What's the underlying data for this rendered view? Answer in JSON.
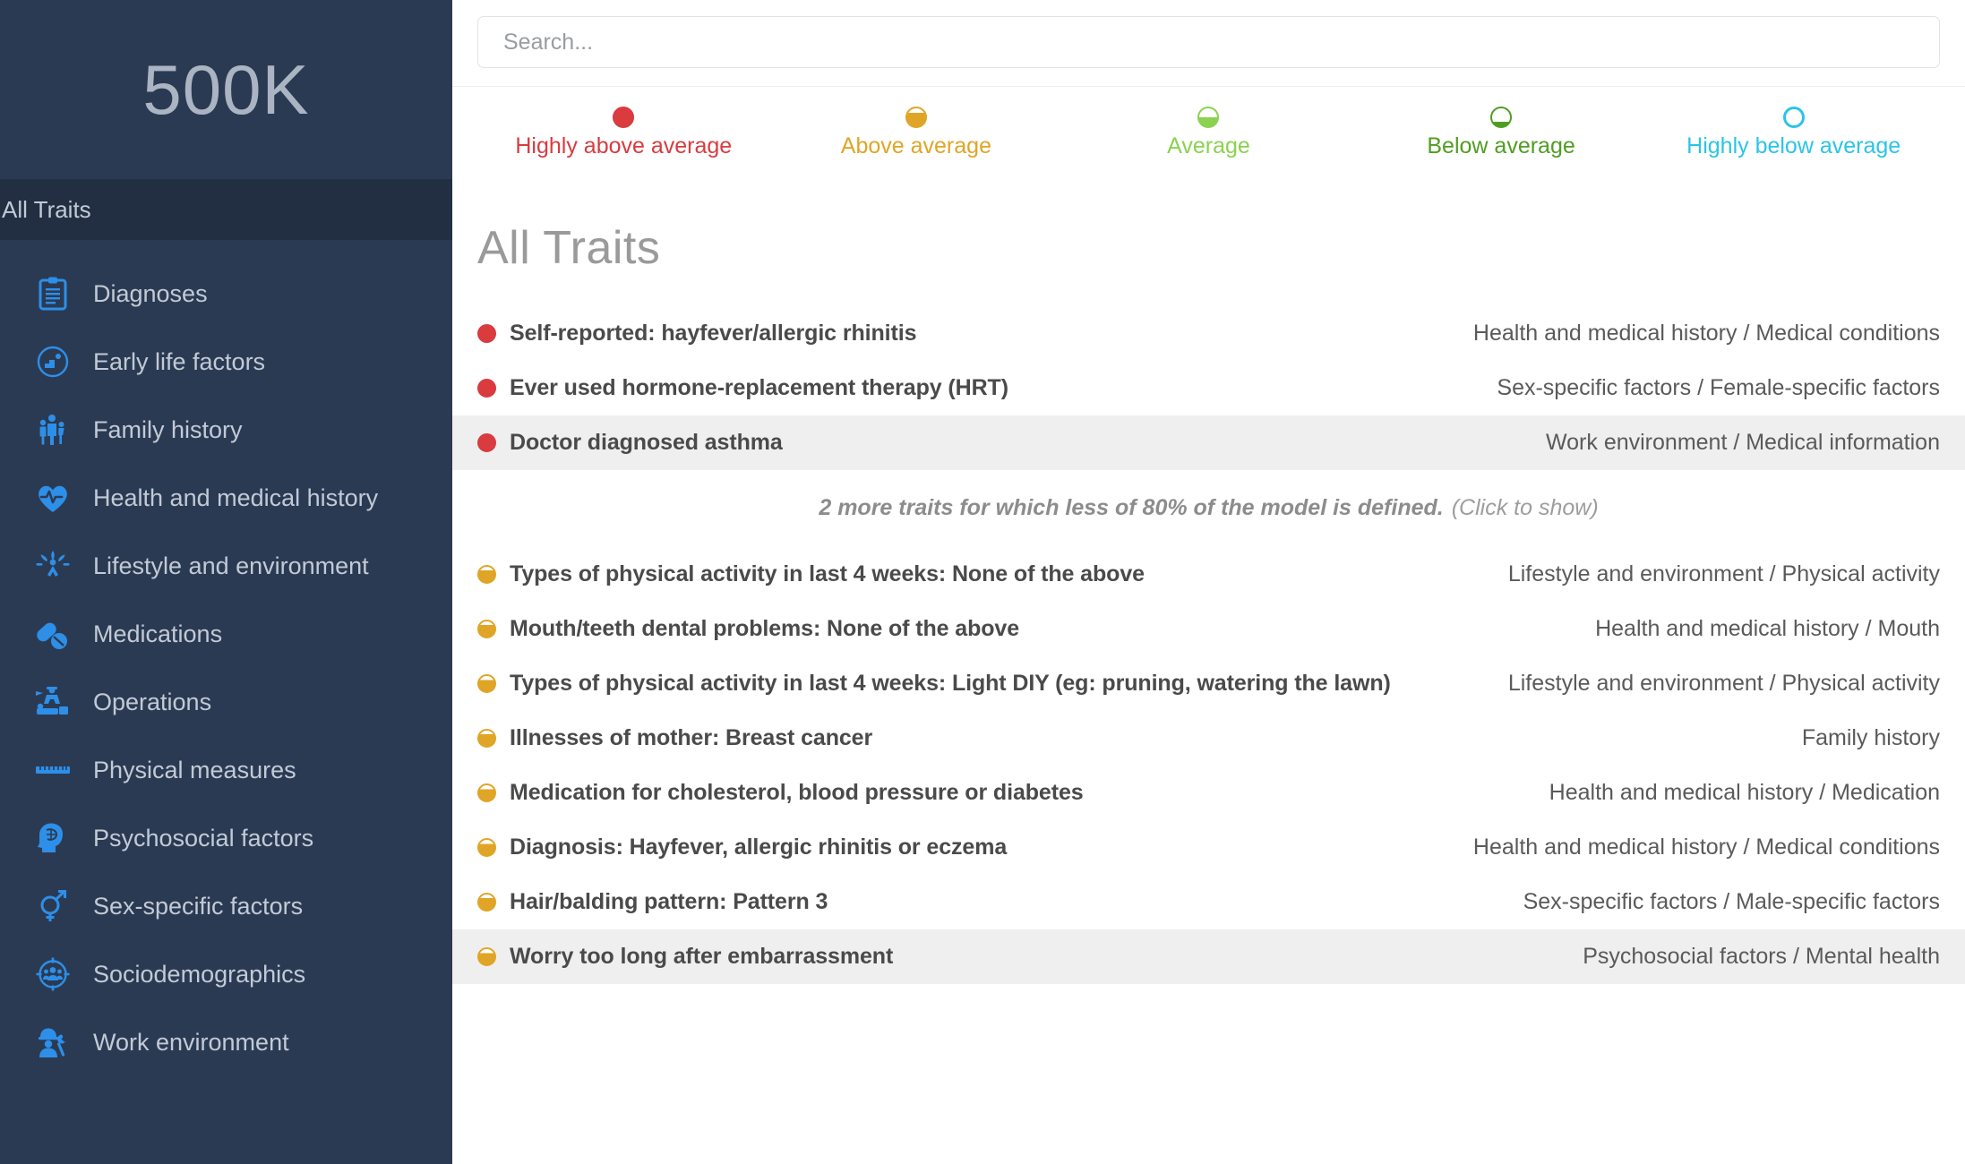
{
  "sidebar": {
    "brand": "500K",
    "active_section": "All Traits",
    "items": [
      {
        "label": "Diagnoses",
        "icon": "clipboard-icon"
      },
      {
        "label": "Early life factors",
        "icon": "baby-icon"
      },
      {
        "label": "Family history",
        "icon": "family-icon"
      },
      {
        "label": "Health and medical history",
        "icon": "heart-pulse-icon"
      },
      {
        "label": "Lifestyle and environment",
        "icon": "lifestyle-tree-icon"
      },
      {
        "label": "Medications",
        "icon": "pills-icon"
      },
      {
        "label": "Operations",
        "icon": "surgery-icon"
      },
      {
        "label": "Physical measures",
        "icon": "ruler-icon"
      },
      {
        "label": "Psychosocial factors",
        "icon": "head-brain-icon"
      },
      {
        "label": "Sex-specific factors",
        "icon": "gender-symbols-icon"
      },
      {
        "label": "Sociodemographics",
        "icon": "people-target-icon"
      },
      {
        "label": "Work environment",
        "icon": "worker-icon"
      }
    ]
  },
  "search": {
    "placeholder": "Search...",
    "value": ""
  },
  "legend": {
    "items": [
      {
        "label": "Highly above average",
        "color": "#d93b3f",
        "fill": 100
      },
      {
        "label": "Above average",
        "color": "#e0a526",
        "fill": 75
      },
      {
        "label": "Average",
        "color": "#8bd24f",
        "fill": 50
      },
      {
        "label": "Below average",
        "color": "#509e21",
        "fill": 25
      },
      {
        "label": "Highly below average",
        "color": "#2bc4e8",
        "fill": 0
      }
    ]
  },
  "main": {
    "title": "All Traits",
    "more_traits_strong": "2 more traits for which less of 80% of the model is defined.",
    "more_traits_click": "(Click to show)"
  },
  "traits_top": [
    {
      "name": "Self-reported: hayfever/allergic rhinitis",
      "category": "Health and medical history / Medical conditions",
      "color": "#d93b3f",
      "fill": 100,
      "shaded": false
    },
    {
      "name": "Ever used hormone-replacement therapy (HRT)",
      "category": "Sex-specific factors / Female-specific factors",
      "color": "#d93b3f",
      "fill": 100,
      "shaded": false
    },
    {
      "name": "Doctor diagnosed asthma",
      "category": "Work environment / Medical information",
      "color": "#d93b3f",
      "fill": 100,
      "shaded": true
    }
  ],
  "traits_bottom": [
    {
      "name": "Types of physical activity in last 4 weeks: None of the above",
      "category": "Lifestyle and environment / Physical activity",
      "color": "#e0a526",
      "fill": 75,
      "shaded": false
    },
    {
      "name": "Mouth/teeth dental problems: None of the above",
      "category": "Health and medical history / Mouth",
      "color": "#e0a526",
      "fill": 75,
      "shaded": false
    },
    {
      "name": "Types of physical activity in last 4 weeks: Light DIY (eg: pruning, watering the lawn)",
      "category": "Lifestyle and environment / Physical activity",
      "color": "#e0a526",
      "fill": 75,
      "shaded": false
    },
    {
      "name": "Illnesses of mother: Breast cancer",
      "category": "Family history",
      "color": "#e0a526",
      "fill": 75,
      "shaded": false
    },
    {
      "name": "Medication for cholesterol, blood pressure or diabetes",
      "category": "Health and medical history / Medication",
      "color": "#e0a526",
      "fill": 75,
      "shaded": false
    },
    {
      "name": "Diagnosis: Hayfever, allergic rhinitis or eczema",
      "category": "Health and medical history / Medical conditions",
      "color": "#e0a526",
      "fill": 75,
      "shaded": false
    },
    {
      "name": "Hair/balding pattern: Pattern 3",
      "category": "Sex-specific factors / Male-specific factors",
      "color": "#e0a526",
      "fill": 75,
      "shaded": false
    },
    {
      "name": "Worry too long after embarrassment",
      "category": "Psychosocial factors / Mental health",
      "color": "#e0a526",
      "fill": 75,
      "shaded": true
    }
  ]
}
